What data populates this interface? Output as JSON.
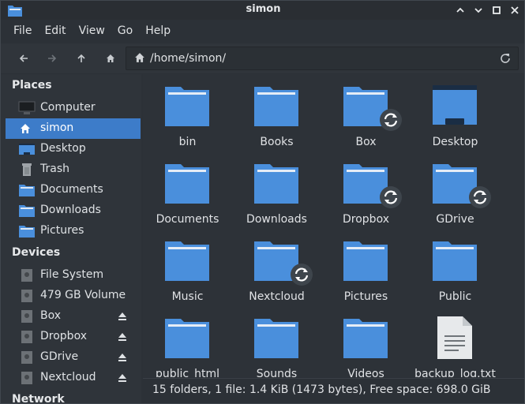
{
  "window": {
    "title": "simon"
  },
  "menubar": [
    "File",
    "Edit",
    "View",
    "Go",
    "Help"
  ],
  "location": {
    "path": "/home/simon/"
  },
  "sidebar": {
    "places_header": "Places",
    "places": [
      {
        "label": "Computer",
        "icon": "computer-icon"
      },
      {
        "label": "simon",
        "icon": "home-icon",
        "selected": true
      },
      {
        "label": "Desktop",
        "icon": "desktop-icon"
      },
      {
        "label": "Trash",
        "icon": "trash-icon"
      },
      {
        "label": "Documents",
        "icon": "folder-icon"
      },
      {
        "label": "Downloads",
        "icon": "folder-icon"
      },
      {
        "label": "Pictures",
        "icon": "folder-icon"
      }
    ],
    "devices_header": "Devices",
    "devices": [
      {
        "label": "File System",
        "icon": "drive-icon"
      },
      {
        "label": "479 GB Volume",
        "icon": "drive-icon"
      },
      {
        "label": "Box",
        "icon": "drive-icon",
        "eject": true
      },
      {
        "label": "Dropbox",
        "icon": "drive-icon",
        "eject": true
      },
      {
        "label": "GDrive",
        "icon": "drive-icon",
        "eject": true
      },
      {
        "label": "Nextcloud",
        "icon": "drive-icon",
        "eject": true
      }
    ],
    "network_header": "Network"
  },
  "files": [
    {
      "name": "bin",
      "type": "folder"
    },
    {
      "name": "Books",
      "type": "folder"
    },
    {
      "name": "Box",
      "type": "folder",
      "sync": true
    },
    {
      "name": "Desktop",
      "type": "desktop"
    },
    {
      "name": "Documents",
      "type": "folder"
    },
    {
      "name": "Downloads",
      "type": "folder"
    },
    {
      "name": "Dropbox",
      "type": "folder",
      "sync": true
    },
    {
      "name": "GDrive",
      "type": "folder",
      "sync": true
    },
    {
      "name": "Music",
      "type": "folder"
    },
    {
      "name": "Nextcloud",
      "type": "folder",
      "sync": true
    },
    {
      "name": "Pictures",
      "type": "folder"
    },
    {
      "name": "Public",
      "type": "folder"
    },
    {
      "name": "public_html",
      "type": "folder"
    },
    {
      "name": "Sounds",
      "type": "folder"
    },
    {
      "name": "Videos",
      "type": "folder"
    },
    {
      "name": "backup_log.txt",
      "type": "text"
    }
  ],
  "status": "15 folders, 1 file: 1.4 KiB (1473 bytes), Free space: 698.0 GiB",
  "colors": {
    "accent": "#3d7cc9",
    "folder": "#4a8fdc",
    "folder_light": "#5ea1e8"
  }
}
